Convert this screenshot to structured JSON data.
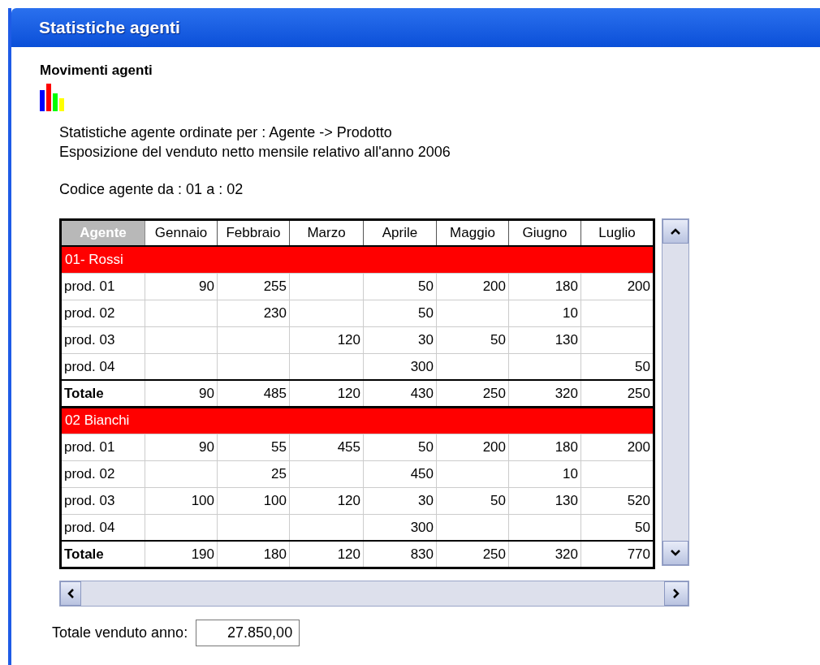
{
  "window": {
    "title": "Statistiche agenti"
  },
  "section_title": "Movimenti agenti",
  "description": [
    "Statistiche agente ordinate per : Agente -> Prodotto",
    "Esposizione del venduto netto mensile relativo all'anno 2006"
  ],
  "range": "Codice agente da : 01 a : 02",
  "table": {
    "columns": [
      "Agente",
      "Gennaio",
      "Febbraio",
      "Marzo",
      "Aprile",
      "Maggio",
      "Giugno",
      "Luglio"
    ],
    "groups": [
      {
        "title": "01- Rossi",
        "rows": [
          {
            "kind": "product",
            "cells": [
              "prod. 01",
              "90",
              "255",
              "",
              "50",
              "200",
              "180",
              "200"
            ]
          },
          {
            "kind": "product",
            "cells": [
              "prod. 02",
              "",
              "230",
              "",
              "50",
              "",
              "10",
              ""
            ]
          },
          {
            "kind": "product",
            "cells": [
              "prod. 03",
              "",
              "",
              "120",
              "30",
              "50",
              "130",
              ""
            ]
          },
          {
            "kind": "product",
            "cells": [
              "prod. 04",
              "",
              "",
              "",
              "300",
              "",
              "",
              "50"
            ]
          },
          {
            "kind": "total",
            "cells": [
              "Totale",
              "90",
              "485",
              "120",
              "430",
              "250",
              "320",
              "250"
            ]
          }
        ]
      },
      {
        "title": "02  Bianchi",
        "rows": [
          {
            "kind": "product",
            "cells": [
              "prod. 01",
              "90",
              "55",
              "455",
              "50",
              "200",
              "180",
              "200"
            ]
          },
          {
            "kind": "product",
            "cells": [
              "prod. 02",
              "",
              "25",
              "",
              "450",
              "",
              "10",
              ""
            ]
          },
          {
            "kind": "product",
            "cells": [
              "prod. 03",
              "100",
              "100",
              "120",
              "30",
              "50",
              "130",
              "520"
            ]
          },
          {
            "kind": "product",
            "cells": [
              "prod. 04",
              "",
              "",
              "",
              "300",
              "",
              "",
              "50"
            ]
          },
          {
            "kind": "total",
            "cells": [
              "Totale",
              "190",
              "180",
              "120",
              "830",
              "250",
              "320",
              "770"
            ]
          }
        ]
      }
    ]
  },
  "total_sold": {
    "label": "Totale venduto anno:",
    "value": "27.850,00"
  }
}
